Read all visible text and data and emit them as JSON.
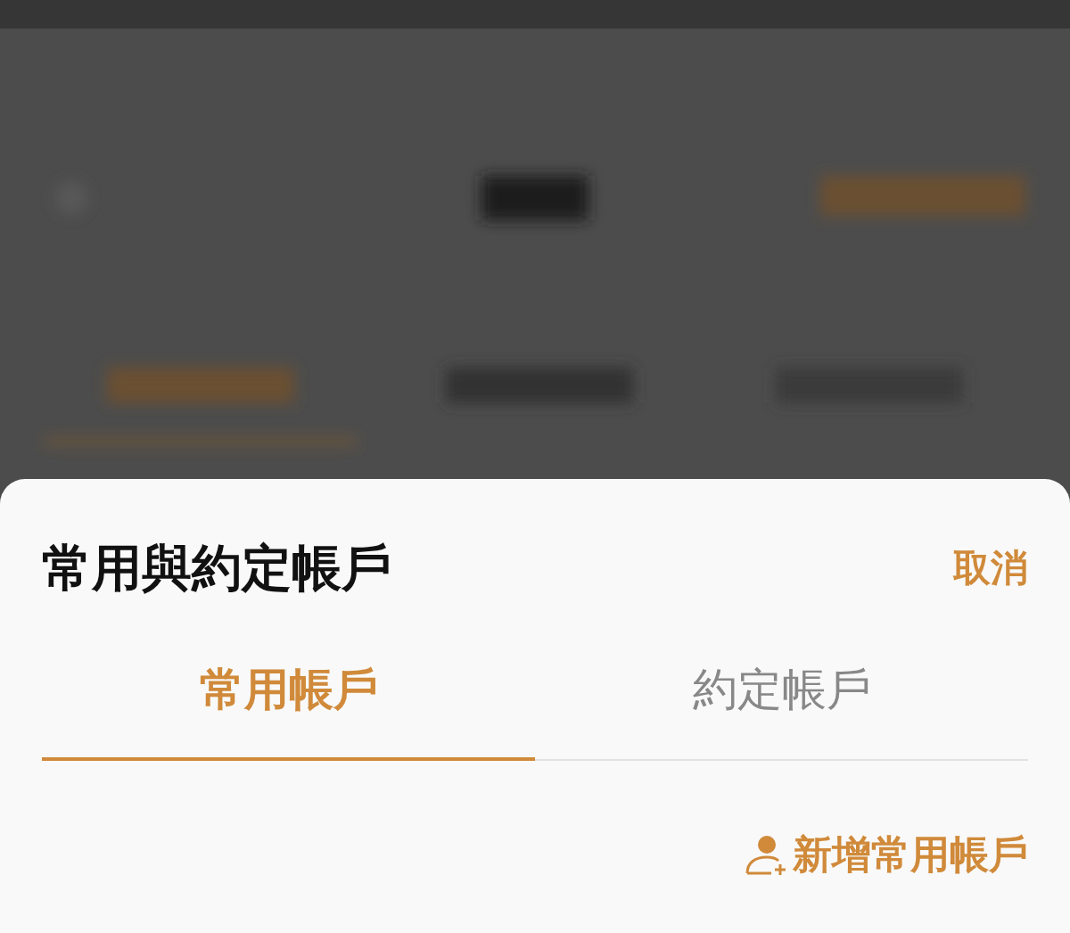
{
  "sheet": {
    "title": "常用與約定帳戶",
    "cancel": "取消"
  },
  "tabs": [
    {
      "label": "常用帳戶",
      "selected": true
    },
    {
      "label": "約定帳戶",
      "selected": false
    }
  ],
  "add_button": {
    "label": "新增常用帳戶"
  }
}
